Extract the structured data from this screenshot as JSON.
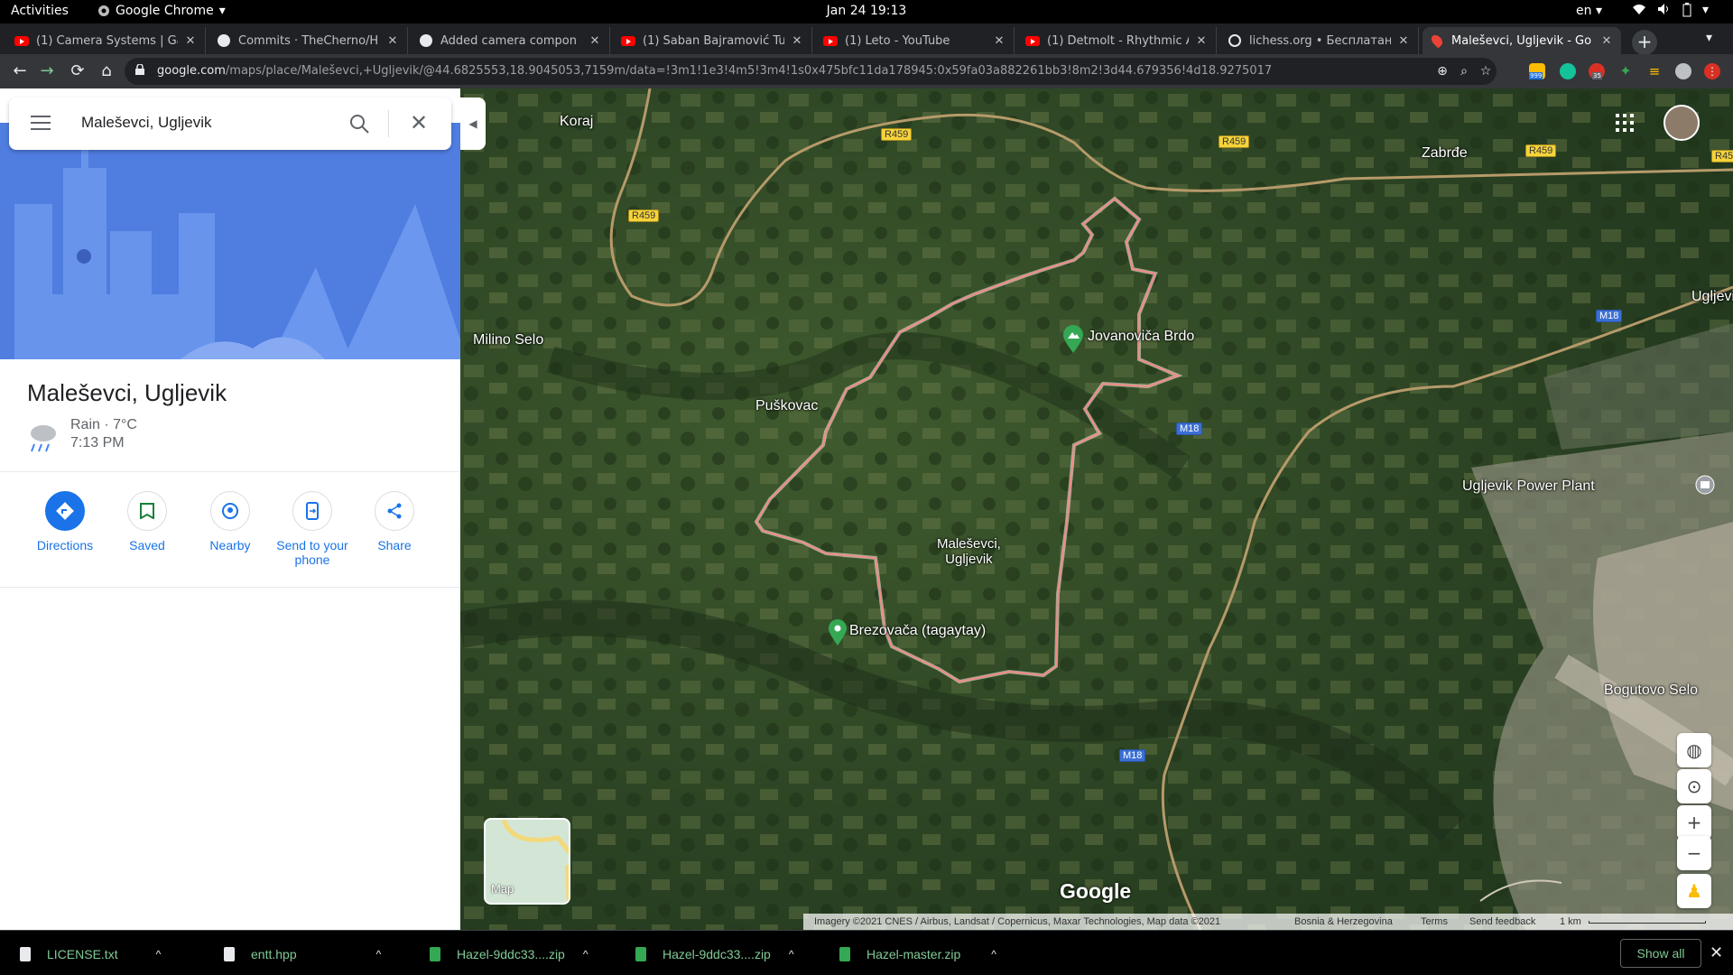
{
  "topbar": {
    "activities": "Activities",
    "app": "Google Chrome",
    "clock": "Jan 24  19:13",
    "lang": "en"
  },
  "tabs": [
    {
      "title": "(1) Camera Systems | Ga",
      "icon": "youtube-icon"
    },
    {
      "title": "Commits · TheCherno/H",
      "icon": "github-icon"
    },
    {
      "title": "Added camera compon",
      "icon": "github-icon"
    },
    {
      "title": "(1) Šaban Bajramović Tu",
      "icon": "youtube-icon"
    },
    {
      "title": "(1) Leto - YouTube",
      "icon": "youtube-icon"
    },
    {
      "title": "(1) Detmolt - Rhythmic A",
      "icon": "youtube-icon"
    },
    {
      "title": "lichess.org • Бесплатан",
      "icon": "lichess-icon"
    },
    {
      "title": "Maleševci, Ugljevik - Go",
      "icon": "maps-pin-icon"
    }
  ],
  "omnibox": {
    "host": "google.com",
    "path": "/maps/place/Maleševci,+Ugljevik/@44.6825553,18.9045053,7159m/data=!3m1!1e3!4m5!3m4!1s0x475bfc11da178945:0x59fa03a882261bb3!8m2!3d44.679356!4d18.9275017"
  },
  "extension_badges": {
    "mail_count": "999",
    "badge_2": "35"
  },
  "panel": {
    "search_value": "Maleševci, Ugljevik",
    "place_title": "Maleševci, Ugljevik",
    "weather": "Rain · 7°C",
    "weather_time": "7:13 PM",
    "actions": [
      "Directions",
      "Saved",
      "Nearby",
      "Send to your\nphone",
      "Share"
    ]
  },
  "map": {
    "labels": {
      "koraj": "Koraj",
      "zabrdje": "Zabrđe",
      "milino": "Milino Selo",
      "puskovac": "Puškovac",
      "jovanovica": "Jovanoviča Brdo",
      "ugljevik": "Ugljevi",
      "power_plant": "Ugljevik Power Plant",
      "malesevci": "Maleševci,\nUgljevik",
      "brezovaca": "Brezovača (tagaytay)",
      "bogutovo": "Bogutovo Selo"
    },
    "road_signs": {
      "r459": "R459",
      "m18": "M18"
    },
    "layer_label": "Map",
    "logo": "Google",
    "attribution": "Imagery ©2021 CNES / Airbus, Landsat / Copernicus, Maxar Technologies, Map data ©2021",
    "country": "Bosnia & Herzegovina",
    "terms": "Terms",
    "feedback": "Send feedback",
    "scale": "1 km"
  },
  "downloads": [
    "LICENSE.txt",
    "entt.hpp",
    "Hazel-9ddc33....zip",
    "Hazel-9ddc33....zip",
    "Hazel-master.zip"
  ],
  "show_all": "Show all"
}
